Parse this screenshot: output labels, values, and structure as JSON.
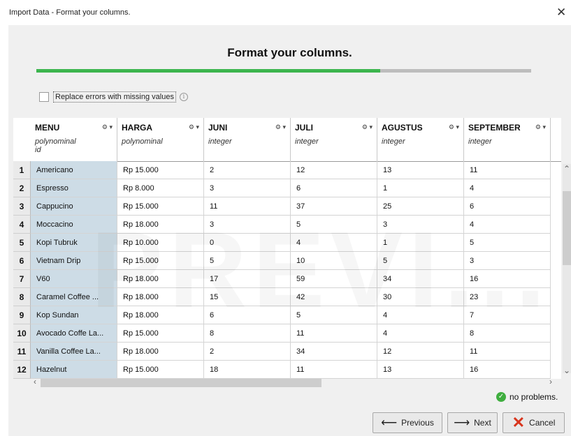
{
  "window": {
    "title": "Import Data - Format your columns.",
    "close_glyph": "✕"
  },
  "heading": "Format your columns.",
  "progress": {
    "fraction": 0.695,
    "fill_color": "#3cb54e",
    "track_color": "#bdbdbd"
  },
  "replace_errors": {
    "label": "Replace errors with missing values",
    "checked": false
  },
  "watermark": "PREVI...",
  "columns": [
    {
      "name": "MENU",
      "type": "polynominal",
      "role": "id"
    },
    {
      "name": "HARGA",
      "type": "polynominal",
      "role": ""
    },
    {
      "name": "JUNI",
      "type": "integer",
      "role": ""
    },
    {
      "name": "JULI",
      "type": "integer",
      "role": ""
    },
    {
      "name": "AGUSTUS",
      "type": "integer",
      "role": ""
    },
    {
      "name": "SEPTEMBER",
      "type": "integer",
      "role": ""
    }
  ],
  "rows": [
    {
      "num": "1",
      "cells": [
        "Americano",
        "Rp 15.000",
        "2",
        "12",
        "13",
        "11"
      ]
    },
    {
      "num": "2",
      "cells": [
        "Espresso",
        "Rp 8.000",
        "3",
        "6",
        "1",
        "4"
      ]
    },
    {
      "num": "3",
      "cells": [
        "Cappucino",
        "Rp 15.000",
        "11",
        "37",
        "25",
        "6"
      ]
    },
    {
      "num": "4",
      "cells": [
        "Moccacino",
        "Rp 18.000",
        "3",
        "5",
        "3",
        "4"
      ]
    },
    {
      "num": "5",
      "cells": [
        "Kopi Tubruk",
        "Rp 10.000",
        "0",
        "4",
        "1",
        "5"
      ]
    },
    {
      "num": "6",
      "cells": [
        "Vietnam Drip",
        "Rp 15.000",
        "5",
        "10",
        "5",
        "3"
      ]
    },
    {
      "num": "7",
      "cells": [
        "V60",
        "Rp 18.000",
        "17",
        "59",
        "34",
        "16"
      ]
    },
    {
      "num": "8",
      "cells": [
        "Caramel Coffee ...",
        "Rp 18.000",
        "15",
        "42",
        "30",
        "23"
      ]
    },
    {
      "num": "9",
      "cells": [
        "Kop Sundan",
        "Rp 18.000",
        "6",
        "5",
        "4",
        "7"
      ]
    },
    {
      "num": "10",
      "cells": [
        "Avocado Coffe La...",
        "Rp 15.000",
        "8",
        "11",
        "4",
        "8"
      ]
    },
    {
      "num": "11",
      "cells": [
        "Vanilla Coffee La...",
        "Rp 18.000",
        "2",
        "34",
        "12",
        "11"
      ]
    },
    {
      "num": "12",
      "cells": [
        "Hazelnut",
        "Rp 15.000",
        "18",
        "11",
        "13",
        "16"
      ]
    }
  ],
  "status": {
    "text": "no problems.",
    "icon": "check-circle-icon",
    "color": "#3fae3f"
  },
  "buttons": {
    "previous": {
      "label": "Previous",
      "icon": "arrow-left-icon"
    },
    "next": {
      "label": "Next",
      "icon": "arrow-right-icon"
    },
    "cancel": {
      "label": "Cancel",
      "icon": "red-x-icon",
      "color": "#d8341c"
    }
  }
}
